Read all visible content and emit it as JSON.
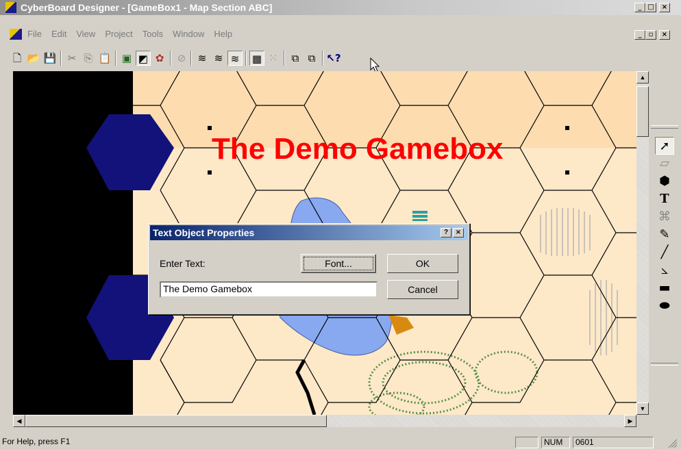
{
  "window": {
    "title": "CyberBoard Designer - [GameBox1 - Map Section ABC]",
    "minimize": "_",
    "maximize": "□",
    "close": "×",
    "mdi_restore": "▫"
  },
  "menu": [
    "File",
    "Edit",
    "View",
    "Project",
    "Tools",
    "Window",
    "Help"
  ],
  "toolbar_icons": [
    "new-icon",
    "open-icon",
    "save-icon",
    "cut-icon",
    "copy-icon",
    "paste-icon",
    "board-icon",
    "tile-icon",
    "color-palette-icon",
    "disabled-tool-icon",
    "layer1-icon",
    "layer2-icon",
    "layer3-icon",
    "grid-icon",
    "snap-grid-icon",
    "bring-front-icon",
    "send-back-icon",
    "context-help-icon"
  ],
  "map": {
    "title_text": "The Demo Gamebox",
    "title_color": "#ff0000",
    "hex_dark_color": "#12127a",
    "background": "#fde8c8",
    "band_color": "#fddcb0",
    "lake_color": "#88a8f0"
  },
  "tools": [
    "select-arrow-icon",
    "eraser-icon",
    "fill-shape-icon",
    "text-tool-icon",
    "color-fill-icon",
    "eyedropper-icon",
    "line-icon",
    "polyline-icon",
    "rectangle-icon",
    "ellipse-icon"
  ],
  "dialog": {
    "title": "Text Object Properties",
    "help_button": "?",
    "close_button": "×",
    "enter_text_label": "Enter Text:",
    "font_button": "Font...",
    "ok_button": "OK",
    "cancel_button": "Cancel",
    "text_value": "The Demo Gamebox"
  },
  "status": {
    "help_text": "For Help, press F1",
    "num": "NUM",
    "coords": "0601"
  }
}
